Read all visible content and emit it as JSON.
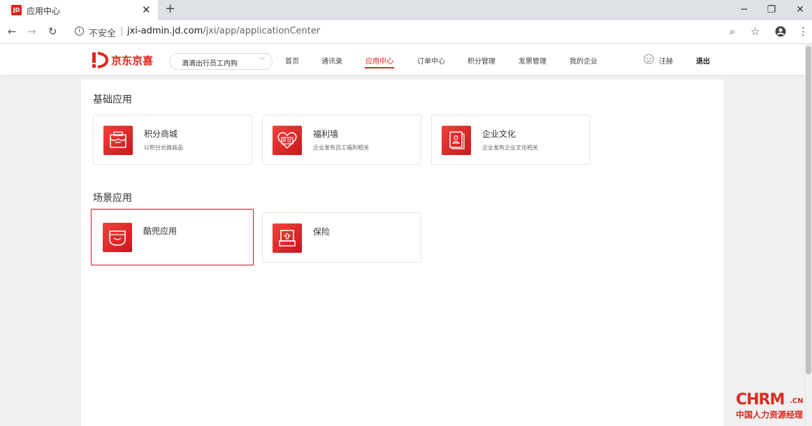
{
  "browser": {
    "tab_title": "应用中心",
    "tab_favicon": "JD",
    "insecure_label": "不安全",
    "separator": "|",
    "url_host": "jxi-admin.jd.com",
    "url_path": "/jxi/app/applicationCenter",
    "icons": [
      "back-arrow-icon",
      "forward-arrow-icon",
      "reload-icon",
      "info-icon",
      "zoom-icon",
      "star-icon",
      "account-icon",
      "menu-icon",
      "minimize-icon",
      "restore-icon",
      "close-icon"
    ]
  },
  "header": {
    "brand": "京东京喜",
    "company_select": "滴滴出行员工内购",
    "nav": [
      {
        "label": "首页"
      },
      {
        "label": "通讯录"
      },
      {
        "label": "应用中心"
      },
      {
        "label": "订单中心"
      },
      {
        "label": "积分管理"
      },
      {
        "label": "发票管理"
      },
      {
        "label": "我的企业"
      }
    ],
    "active_nav": "应用中心",
    "user_name": "汪赫",
    "logout": "退出"
  },
  "sections": [
    {
      "title": "基础应用",
      "cards": [
        {
          "title": "积分商城",
          "desc": "以积分兑换商品",
          "icon": "shop-icon"
        },
        {
          "title": "福利墙",
          "desc": "企业发布员工福利相关",
          "icon": "heart-mail-icon"
        },
        {
          "title": "企业文化",
          "desc": "企业发布企业文化相关",
          "icon": "book-icon"
        }
      ]
    },
    {
      "title": "场景应用",
      "cards": [
        {
          "title": "酷兜应用",
          "desc": "",
          "icon": "pocket-icon"
        },
        {
          "title": "保险",
          "desc": "",
          "icon": "insurance-box-icon"
        }
      ]
    }
  ],
  "colors": {
    "accent": "#e1251b",
    "icon_gradient_start": "#f0433a",
    "icon_gradient_end": "#c9161d",
    "highlight_border": "#c8161d"
  },
  "watermark": {
    "main": "CHRM",
    "suffix": ".CN",
    "sub": "中国人力资源经理"
  }
}
